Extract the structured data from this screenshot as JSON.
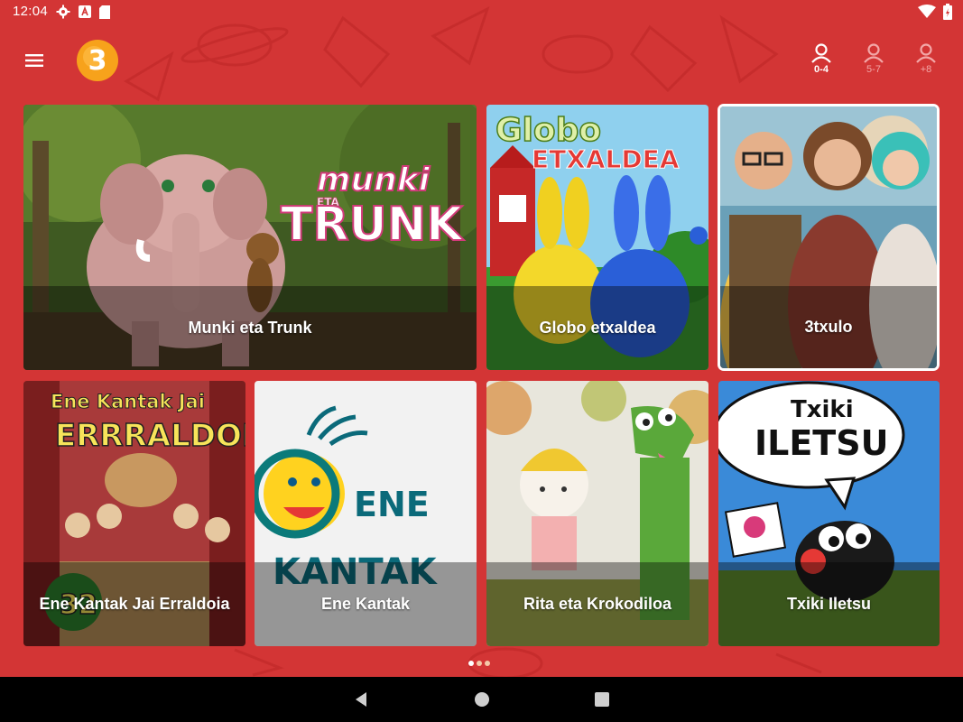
{
  "status_bar": {
    "time": "12:04",
    "icons_left": [
      "settings-icon",
      "a-badge-icon",
      "sd-card-icon"
    ],
    "icons_right": [
      "wifi-icon",
      "battery-icon"
    ]
  },
  "app_bar": {
    "menu_icon": "hamburger-menu-icon",
    "logo_text": "3",
    "age_tabs": [
      {
        "label": "0-4",
        "active": true
      },
      {
        "label": "5-7",
        "active": false
      },
      {
        "label": "+8",
        "active": false
      }
    ]
  },
  "shows": [
    {
      "title": "Munki eta Trunk",
      "art_text": [
        "munki",
        "ETA",
        "TRUNK"
      ]
    },
    {
      "title": "Globo etxaldea",
      "art_text": [
        "Globo",
        "ETXALDEA"
      ]
    },
    {
      "title": "3txulo",
      "selected": true
    },
    {
      "title": "Ene Kantak Jai Erraldoia",
      "art_text": [
        "Ene Kantak Jai",
        "ERRRALDOIA",
        "32"
      ]
    },
    {
      "title": "Ene Kantak",
      "art_text": [
        "ENE",
        "KANTAK"
      ]
    },
    {
      "title": "Rita eta Krokodiloa"
    },
    {
      "title": "Txiki Iletsu",
      "art_text": [
        "Txiki",
        "ILETSU"
      ]
    }
  ],
  "pager": {
    "pages": 3,
    "current": 1
  },
  "nav_bar": [
    "back-icon",
    "home-icon",
    "recents-icon"
  ],
  "colors": {
    "background": "#d33535",
    "accent": "#ffffff",
    "logo": "#f7a21b"
  }
}
